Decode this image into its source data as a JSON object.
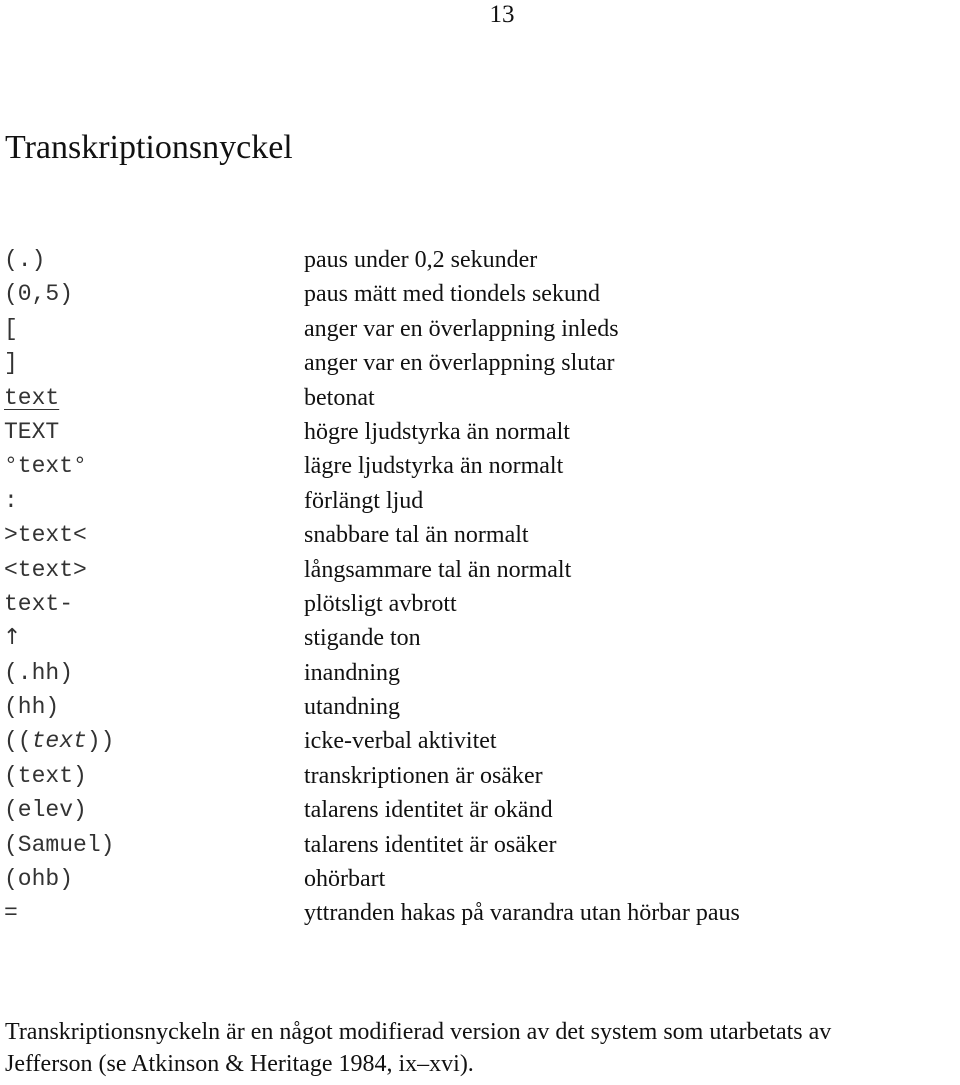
{
  "page": {
    "number": "13",
    "title": "Transkriptionsnyckel"
  },
  "key": [
    {
      "symbol": "(.)",
      "meaning": "paus under 0,2 sekunder"
    },
    {
      "symbol": "(0,5)",
      "meaning": "paus mätt med tiondels sekund"
    },
    {
      "symbol": "[",
      "meaning": "anger var en överlappning inleds"
    },
    {
      "symbol": "]",
      "meaning": "anger var en överlappning slutar"
    },
    {
      "symbol": "text",
      "meaning": "betonat"
    },
    {
      "symbol": "TEXT",
      "meaning": "högre ljudstyrka än normalt"
    },
    {
      "symbol": "°text°",
      "meaning": "lägre ljudstyrka än normalt"
    },
    {
      "symbol": ":",
      "meaning": "förlängt ljud"
    },
    {
      "symbol": ">text<",
      "meaning": "snabbare tal än normalt"
    },
    {
      "symbol": "<text>",
      "meaning": "långsammare tal än normalt"
    },
    {
      "symbol": "text-",
      "meaning": "plötsligt avbrott"
    },
    {
      "symbol": "↑",
      "meaning": "stigande ton"
    },
    {
      "symbol": "(.hh)",
      "meaning": "inandning"
    },
    {
      "symbol": "(hh)",
      "meaning": "utandning"
    },
    {
      "symbol_pre": "((",
      "symbol_italic": "text",
      "symbol_post": "))",
      "meaning": "icke-verbal aktivitet"
    },
    {
      "symbol": "(text)",
      "meaning": "transkriptionen är osäker"
    },
    {
      "symbol": "(elev)",
      "meaning": "talarens identitet är okänd"
    },
    {
      "symbol": "(Samuel)",
      "meaning": "talarens identitet är osäker"
    },
    {
      "symbol": "(ohb)",
      "meaning": "ohörbart"
    },
    {
      "symbol": "=",
      "meaning": "yttranden hakas på varandra utan hörbar paus"
    }
  ],
  "footer": {
    "line1": "Transkriptionsnyckeln är en något modifierad version av det system som utarbetats av",
    "line2": "Jefferson (se Atkinson & Heritage 1984, ix–xvi)."
  }
}
